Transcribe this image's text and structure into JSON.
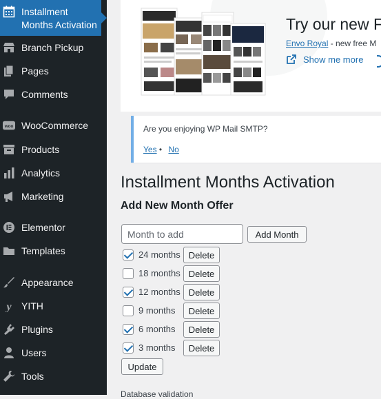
{
  "sidebar": {
    "active": {
      "label_line1": "Installment",
      "label_line2": "Months Activation",
      "icon": "calendar-icon"
    },
    "items": [
      {
        "label": "Branch Pickup",
        "icon": "store-icon"
      },
      {
        "label": "Pages",
        "icon": "pages-icon"
      },
      {
        "label": "Comments",
        "icon": "comment-icon"
      },
      {
        "label": "WooCommerce",
        "icon": "woo-icon"
      },
      {
        "label": "Products",
        "icon": "archive-icon"
      },
      {
        "label": "Analytics",
        "icon": "bar-chart-icon"
      },
      {
        "label": "Marketing",
        "icon": "megaphone-icon"
      },
      {
        "label": "Elementor",
        "icon": "elementor-icon"
      },
      {
        "label": "Templates",
        "icon": "folder-icon"
      },
      {
        "label": "Appearance",
        "icon": "brush-icon"
      },
      {
        "label": "YITH",
        "icon": "yith-icon"
      },
      {
        "label": "Plugins",
        "icon": "plugin-icon"
      },
      {
        "label": "Users",
        "icon": "user-icon"
      },
      {
        "label": "Tools",
        "icon": "wrench-icon"
      }
    ]
  },
  "promo": {
    "title": "Try our new F",
    "theme_link": "Envo Royal",
    "subtitle_rest": " - new free M",
    "show_more": "Show me more"
  },
  "notice": {
    "question": "Are you enjoying WP Mail SMTP?",
    "yes": "Yes",
    "separator": "•",
    "no": "No"
  },
  "page": {
    "title": "Installment Months Activation",
    "section_title": "Add New Month Offer",
    "input_placeholder": "Month to add",
    "input_value": "",
    "add_button": "Add Month",
    "months": [
      {
        "label": "24 months",
        "checked": true,
        "delete": "Delete"
      },
      {
        "label": "18 months",
        "checked": false,
        "delete": "Delete"
      },
      {
        "label": "12 months",
        "checked": true,
        "delete": "Delete"
      },
      {
        "label": "9 months",
        "checked": false,
        "delete": "Delete"
      },
      {
        "label": "6 months",
        "checked": true,
        "delete": "Delete"
      },
      {
        "label": "3 months",
        "checked": true,
        "delete": "Delete"
      }
    ],
    "update_button": "Update",
    "footer_text": "Database validation"
  },
  "colors": {
    "sidebar_bg": "#1d2327",
    "accent": "#2271b1",
    "notice_border": "#72aee6",
    "page_bg": "#f0f0f1"
  }
}
